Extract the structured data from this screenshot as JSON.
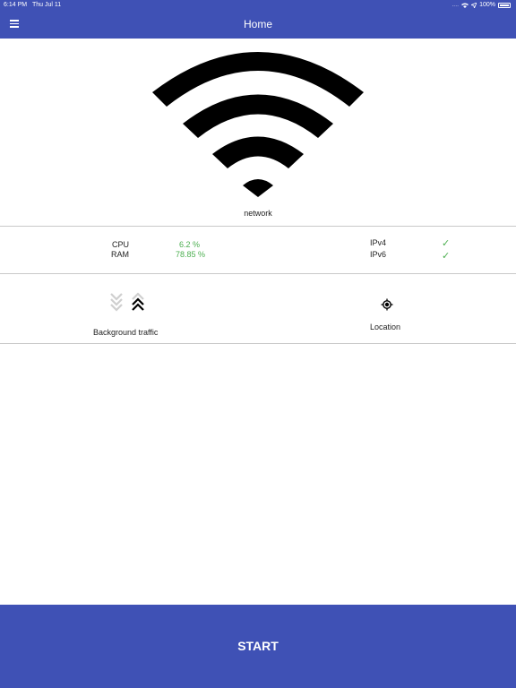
{
  "statusbar": {
    "time": "6:14 PM",
    "date": "Thu Jul 11",
    "signal": "....",
    "battery": "100%"
  },
  "appbar": {
    "title": "Home",
    "menu_icon": "hamburger-menu-icon"
  },
  "network": {
    "icon": "wifi-icon",
    "label": "network"
  },
  "stats": {
    "cpu_label": "CPU",
    "cpu_value": "6.2 %",
    "ram_label": "RAM",
    "ram_value": "78.85 %",
    "ipv4_label": "IPv4",
    "ipv4_status": "✓",
    "ipv6_label": "IPv6",
    "ipv6_status": "✓",
    "ok_color": "#4caf50"
  },
  "features": {
    "background_traffic_label": "Background traffic",
    "location_label": "Location"
  },
  "start_button": {
    "label": "START"
  },
  "colors": {
    "primary": "#3f51b5"
  }
}
